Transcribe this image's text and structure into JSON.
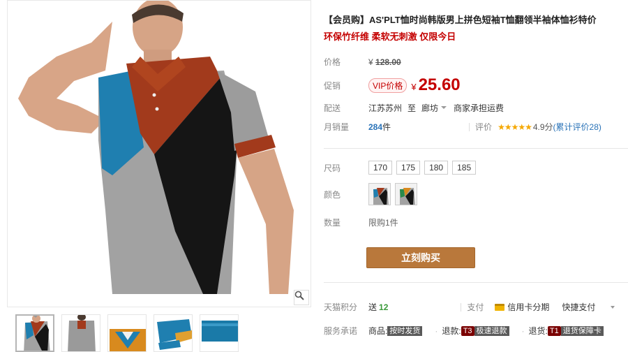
{
  "gallery": {
    "zoom_icon": "magnifier-icon",
    "thumbnails": [
      "front-view",
      "back-view",
      "collar-closeup",
      "sleeve-closeup",
      "fabric-closeup"
    ]
  },
  "product": {
    "title": "【会员购】AS'PLT恤时尚韩版男上拼色短袖T恤翻领半袖体恤衫特价",
    "subtitle": "环保竹纤维 柔软无刺激 仅限今日"
  },
  "price": {
    "label": "价格",
    "currency": "¥",
    "original": "128.00"
  },
  "promo": {
    "label": "促销",
    "vip_tag": "VIP价格",
    "currency": "¥",
    "value": "25.60"
  },
  "shipping": {
    "label": "配送",
    "from": "江苏苏州",
    "to_word": "至",
    "to": "廊坊",
    "fee_note": "商家承担运费"
  },
  "sales": {
    "label": "月销量",
    "count": "284",
    "unit": "件",
    "rating_label": "评价",
    "stars": "★★★★★",
    "score": "4.9分",
    "reviews": "(累计评价28)"
  },
  "size": {
    "label": "尺码",
    "options": [
      "170",
      "175",
      "180",
      "185"
    ]
  },
  "color": {
    "label": "颜色"
  },
  "quantity": {
    "label": "数量",
    "limit": "限购1件"
  },
  "buy_button": "立刻购买",
  "points": {
    "label": "天猫积分",
    "prefix": "送",
    "value": "12"
  },
  "payment": {
    "label": "支付",
    "card": "信用卡分期",
    "quick": "快捷支付"
  },
  "service": {
    "label": "服务承诺",
    "item1_prefix": "商品:",
    "item1_badge": "按时发货",
    "item2_prefix": "退款:",
    "item2_tag": "T3",
    "item2_badge": "极速退款",
    "item3_prefix": "退货:",
    "item3_tag": "T1",
    "item3_badge": "退货保障卡"
  },
  "colors": {
    "accent_red": "#c40000",
    "buy_button": "#b9783b",
    "link_blue": "#2a73b8"
  }
}
